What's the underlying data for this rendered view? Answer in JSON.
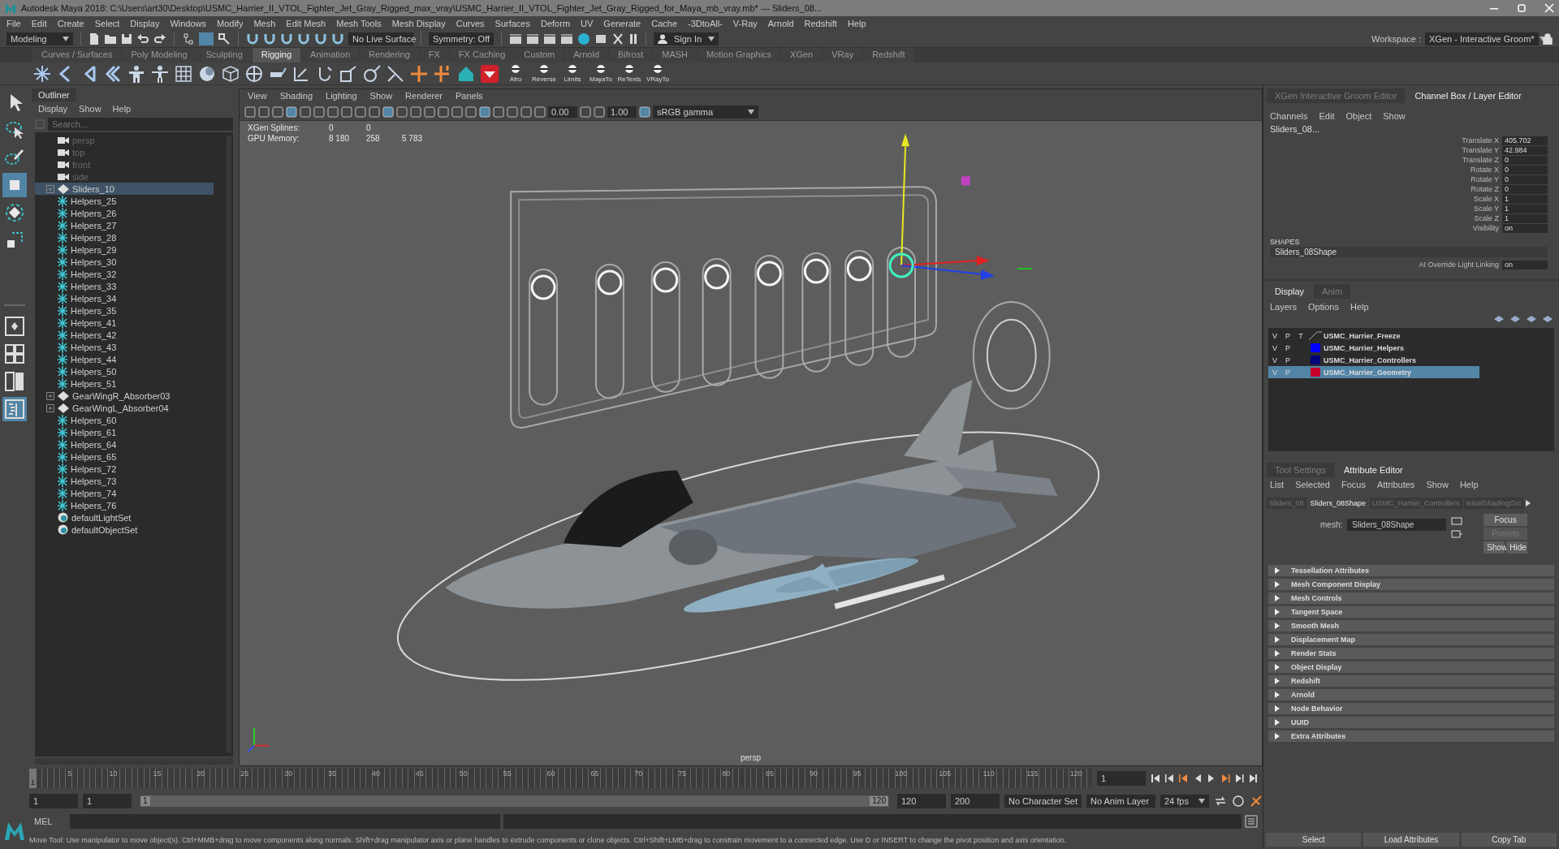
{
  "window": {
    "title": "Autodesk Maya 2018: C:\\Users\\art30\\Desktop\\USMC_Harrier_II_VTOL_Fighter_Jet_Gray_Rigged_max_vray\\USMC_Harrier_II_VTOL_Fighter_Jet_Gray_Rigged_for_Maya_mb_vray.mb*  ---  Sliders_08..."
  },
  "menu": [
    "File",
    "Edit",
    "Create",
    "Select",
    "Display",
    "Windows",
    "Modify",
    "Mesh",
    "Edit Mesh",
    "Mesh Tools",
    "Mesh Display",
    "Curves",
    "Surfaces",
    "Deform",
    "UV",
    "Generate",
    "Cache",
    "-3DtoAll-",
    "V-Ray",
    "Arnold",
    "Redshift",
    "Help"
  ],
  "status_line": {
    "mode": "Modeling",
    "live_surface": "No Live Surface",
    "symmetry": "Symmetry: Off",
    "sign_in": "Sign In",
    "workspace_label": "Workspace :",
    "workspace": "XGen - Interactive Groom*"
  },
  "shelf": {
    "tabs": [
      {
        "label": "Curves / Surfaces",
        "selected": false
      },
      {
        "label": "Poly Modeling",
        "selected": false
      },
      {
        "label": "Sculpting",
        "selected": false
      },
      {
        "label": "Rigging",
        "selected": true
      },
      {
        "label": "Animation",
        "selected": false
      },
      {
        "label": "Rendering",
        "selected": false
      },
      {
        "label": "FX",
        "selected": false
      },
      {
        "label": "FX Caching",
        "selected": false
      },
      {
        "label": "Custom",
        "selected": false
      },
      {
        "label": "Arnold",
        "selected": false
      },
      {
        "label": "Bifrost",
        "selected": false
      },
      {
        "label": "MASH",
        "selected": false
      },
      {
        "label": "Motion Graphics",
        "selected": false
      },
      {
        "label": "XGen",
        "selected": false
      },
      {
        "label": "VRay",
        "selected": false
      },
      {
        "label": "Redshift",
        "selected": false
      }
    ],
    "labeled_buttons": [
      "Afro",
      "Reverse",
      "Limits",
      "MayaTo",
      "ReTexts",
      "VRayTo"
    ]
  },
  "toolbox": [
    {
      "kind": "select",
      "selected": false
    },
    {
      "kind": "lasso",
      "selected": false
    },
    {
      "kind": "paint",
      "selected": false
    },
    {
      "kind": "move",
      "selected": true
    },
    {
      "kind": "rotate",
      "selected": false
    },
    {
      "kind": "scale",
      "selected": false
    }
  ],
  "layouts": [
    {
      "kind": "single",
      "selected": false
    },
    {
      "kind": "four",
      "selected": false
    },
    {
      "kind": "two",
      "selected": false
    },
    {
      "kind": "outliner",
      "selected": true
    }
  ],
  "outliner": {
    "title": "Outliner",
    "menu": [
      "Display",
      "Show",
      "Help"
    ],
    "search_placeholder": "Search...",
    "items": [
      {
        "label": "persp",
        "kind": "camera",
        "selected": false
      },
      {
        "label": "top",
        "kind": "camera",
        "selected": false
      },
      {
        "label": "front",
        "kind": "camera",
        "selected": false
      },
      {
        "label": "side",
        "kind": "camera",
        "selected": false
      },
      {
        "label": "Sliders_10",
        "kind": "group",
        "selected": true
      },
      {
        "label": "Helpers_25",
        "kind": "helper",
        "selected": false
      },
      {
        "label": "Helpers_26",
        "kind": "helper",
        "selected": false
      },
      {
        "label": "Helpers_27",
        "kind": "helper",
        "selected": false
      },
      {
        "label": "Helpers_28",
        "kind": "helper",
        "selected": false
      },
      {
        "label": "Helpers_29",
        "kind": "helper",
        "selected": false
      },
      {
        "label": "Helpers_30",
        "kind": "helper",
        "selected": false
      },
      {
        "label": "Helpers_32",
        "kind": "helper",
        "selected": false
      },
      {
        "label": "Helpers_33",
        "kind": "helper",
        "selected": false
      },
      {
        "label": "Helpers_34",
        "kind": "helper",
        "selected": false
      },
      {
        "label": "Helpers_35",
        "kind": "helper",
        "selected": false
      },
      {
        "label": "Helpers_41",
        "kind": "helper",
        "selected": false
      },
      {
        "label": "Helpers_42",
        "kind": "helper",
        "selected": false
      },
      {
        "label": "Helpers_43",
        "kind": "helper",
        "selected": false
      },
      {
        "label": "Helpers_44",
        "kind": "helper",
        "selected": false
      },
      {
        "label": "Helpers_50",
        "kind": "helper",
        "selected": false
      },
      {
        "label": "Helpers_51",
        "kind": "helper",
        "selected": false
      },
      {
        "label": "GearWingR_Absorber03",
        "kind": "group",
        "selected": false
      },
      {
        "label": "GearWingL_Absorber04",
        "kind": "group",
        "selected": false
      },
      {
        "label": "Helpers_60",
        "kind": "helper",
        "selected": false
      },
      {
        "label": "Helpers_61",
        "kind": "helper",
        "selected": false
      },
      {
        "label": "Helpers_64",
        "kind": "helper",
        "selected": false
      },
      {
        "label": "Helpers_65",
        "kind": "helper",
        "selected": false
      },
      {
        "label": "Helpers_72",
        "kind": "helper",
        "selected": false
      },
      {
        "label": "Helpers_73",
        "kind": "helper",
        "selected": false
      },
      {
        "label": "Helpers_74",
        "kind": "helper",
        "selected": false
      },
      {
        "label": "Helpers_76",
        "kind": "helper",
        "selected": false
      },
      {
        "label": "defaultLightSet",
        "kind": "set",
        "selected": false
      },
      {
        "label": "defaultObjectSet",
        "kind": "set",
        "selected": false
      }
    ]
  },
  "viewport": {
    "menu": [
      "View",
      "Shading",
      "Lighting",
      "Show",
      "Renderer",
      "Panels"
    ],
    "exposure": "0.00",
    "gamma": "1.00",
    "color_space": "sRGB gamma",
    "hud": [
      {
        "label": "XGen Splines:",
        "values": [
          "0",
          "0"
        ]
      },
      {
        "label": "GPU Memory:",
        "values": [
          "8 180",
          "258",
          "5 783"
        ]
      }
    ],
    "camera": "persp"
  },
  "channel_box": {
    "tabs": [
      {
        "label": "XGen Interactive Groom Editor",
        "selected": false
      },
      {
        "label": "Channel Box / Layer Editor",
        "selected": true
      }
    ],
    "menu": [
      "Channels",
      "Edit",
      "Object",
      "Show"
    ],
    "object": "Sliders_08...",
    "channels": [
      {
        "name": "Translate X",
        "value": "405.702"
      },
      {
        "name": "Translate Y",
        "value": "42.984"
      },
      {
        "name": "Translate Z",
        "value": "0"
      },
      {
        "name": "Rotate X",
        "value": "0"
      },
      {
        "name": "Rotate Y",
        "value": "0"
      },
      {
        "name": "Rotate Z",
        "value": "0"
      },
      {
        "name": "Scale X",
        "value": "1"
      },
      {
        "name": "Scale Y",
        "value": "1"
      },
      {
        "name": "Scale Z",
        "value": "1"
      },
      {
        "name": "Visibility",
        "value": "on"
      }
    ],
    "shapes_heading": "SHAPES",
    "shape": "Sliders_08Shape",
    "shape_channels": [
      {
        "name": "AI Override Light Linking",
        "value": "on"
      }
    ]
  },
  "layer_editor": {
    "tabs": [
      {
        "label": "Display",
        "selected": true
      },
      {
        "label": "Anim",
        "selected": false
      }
    ],
    "menu": [
      "Layers",
      "Options",
      "Help"
    ],
    "layers": [
      {
        "flags": [
          "V",
          "P",
          "T"
        ],
        "name": "USMC_Harrier_Freeze",
        "selected": false
      },
      {
        "flags": [
          "V",
          "P"
        ],
        "name": "USMC_Harrier_Helpers",
        "color": "#0000ff",
        "selected": false
      },
      {
        "flags": [
          "V",
          "P"
        ],
        "name": "USMC_Harrier_Controllers",
        "color": "#00007a",
        "selected": false
      },
      {
        "flags": [
          "V",
          "P"
        ],
        "name": "USMC_Harrier_Geometry",
        "color": "#c4002c",
        "selected": true
      }
    ]
  },
  "attribute_editor": {
    "tabs": [
      {
        "label": "Tool Settings",
        "selected": false
      },
      {
        "label": "Attribute Editor",
        "selected": true
      }
    ],
    "menu": [
      "List",
      "Selected",
      "Focus",
      "Attributes",
      "Show",
      "Help"
    ],
    "node_tabs": [
      {
        "label": "Sliders_08",
        "selected": false
      },
      {
        "label": "Sliders_08Shape",
        "selected": true
      },
      {
        "label": "USMC_Harrier_Controllers",
        "selected": false
      },
      {
        "label": "initialShadingGrc",
        "selected": false
      }
    ],
    "field_label": "mesh:",
    "field_value": "Sliders_08Shape",
    "buttons": [
      {
        "label": "Focus",
        "disabled": false
      },
      {
        "label": "Presets",
        "disabled": true
      },
      {
        "label": "Show",
        "disabled": false
      },
      {
        "label": "Hide",
        "disabled": false
      }
    ],
    "sections": [
      "Tessellation Attributes",
      "Mesh Component Display",
      "Mesh Controls",
      "Tangent Space",
      "Smooth Mesh",
      "Displacement Map",
      "Render Stats",
      "Object Display",
      "Redshift",
      "Arnold",
      "Node Behavior",
      "UUID",
      "Extra Attributes"
    ],
    "bottom_buttons": [
      "Select",
      "Load Attributes",
      "Copy Tab"
    ]
  },
  "time_slider": {
    "level": 0,
    "current_frame": "1",
    "ticks": [
      "5",
      "10",
      "15",
      "20",
      "25",
      "30",
      "35",
      "40",
      "45",
      "50",
      "55",
      "60",
      "65",
      "70",
      "75",
      "80",
      "85",
      "90",
      "95",
      "100",
      "105",
      "110",
      "115",
      "120"
    ],
    "frame_field": "1"
  },
  "range_slider": {
    "level": 1,
    "start": "1",
    "playback_start": "1",
    "range_start": "1",
    "range_end": "120",
    "playback_end": "120",
    "end": "200",
    "character_set": "No Character Set",
    "anim_layer": "No Anim Layer",
    "fps": "24 fps"
  },
  "command_line": {
    "language": "MEL"
  },
  "help_line": "Move Tool: Use manipulator to move object(s). Ctrl+MMB+drag to move components along normals. Shift+drag manipulator axis or plane handles to extrude components or clone objects. Ctrl+Shift+LMB+drag to constrain movement to a connected edge. Use D or INSERT to change the pivot position and axis orientation."
}
